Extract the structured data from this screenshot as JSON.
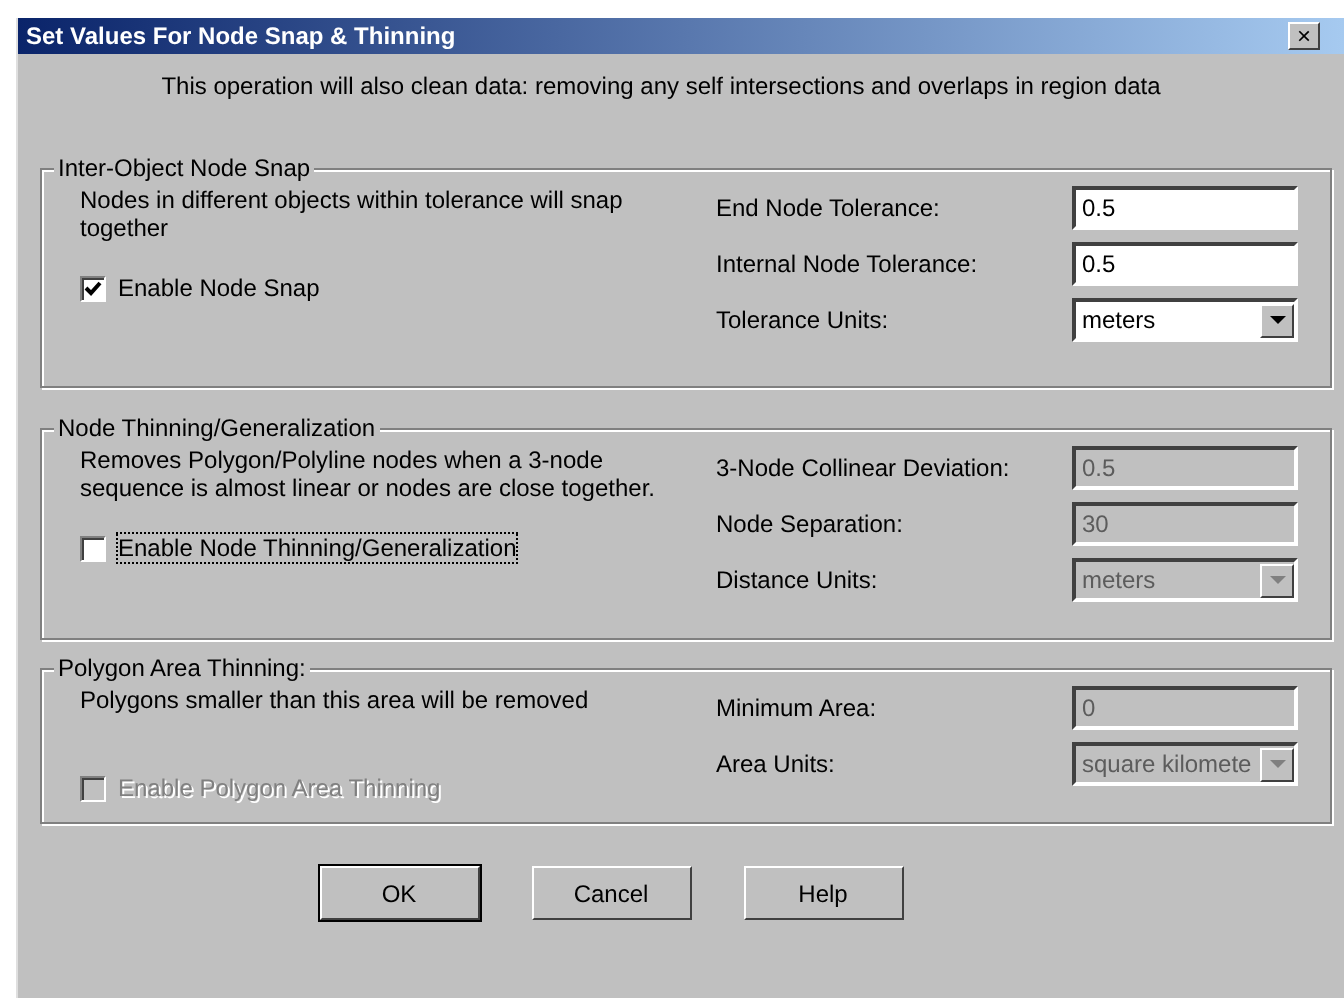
{
  "window": {
    "title": "Set Values For Node Snap & Thinning",
    "close_label": "×"
  },
  "intro": "This operation will also clean data: removing any self intersections and overlaps in region data",
  "groups": [
    {
      "title": "Inter-Object Node Snap",
      "description": "Nodes in different objects within tolerance will snap together",
      "checkbox": {
        "label": "Enable Node Snap",
        "checked": true,
        "disabled": false,
        "focused": false
      },
      "fields": [
        {
          "label": "End Node Tolerance:",
          "kind": "text",
          "value": "0.5",
          "disabled": false
        },
        {
          "label": "Internal Node Tolerance:",
          "kind": "text",
          "value": "0.5",
          "disabled": false
        },
        {
          "label": "Tolerance Units:",
          "kind": "select",
          "value": "meters",
          "disabled": false
        }
      ]
    },
    {
      "title": "Node Thinning/Generalization",
      "description": "Removes Polygon/Polyline nodes when a 3-node sequence is almost linear or nodes are close together.",
      "checkbox": {
        "label": "Enable Node Thinning/Generalization",
        "checked": false,
        "disabled": false,
        "focused": true
      },
      "fields": [
        {
          "label": "3-Node Collinear Deviation:",
          "kind": "text",
          "value": "0.5",
          "disabled": true
        },
        {
          "label": "Node Separation:",
          "kind": "text",
          "value": "30",
          "disabled": true
        },
        {
          "label": "Distance Units:",
          "kind": "select",
          "value": "meters",
          "disabled": true
        }
      ]
    },
    {
      "title": "Polygon Area Thinning:",
      "description": "Polygons smaller than this area will be removed",
      "checkbox": {
        "label": "Enable Polygon Area Thinning",
        "checked": false,
        "disabled": true,
        "focused": false
      },
      "fields": [
        {
          "label": "Minimum Area:",
          "kind": "text",
          "value": "0",
          "disabled": true
        },
        {
          "label": "Area Units:",
          "kind": "select",
          "value": "square kilomete",
          "disabled": true
        }
      ]
    }
  ],
  "buttons": [
    {
      "label": "OK",
      "default": true
    },
    {
      "label": "Cancel",
      "default": false
    },
    {
      "label": "Help",
      "default": false
    }
  ]
}
